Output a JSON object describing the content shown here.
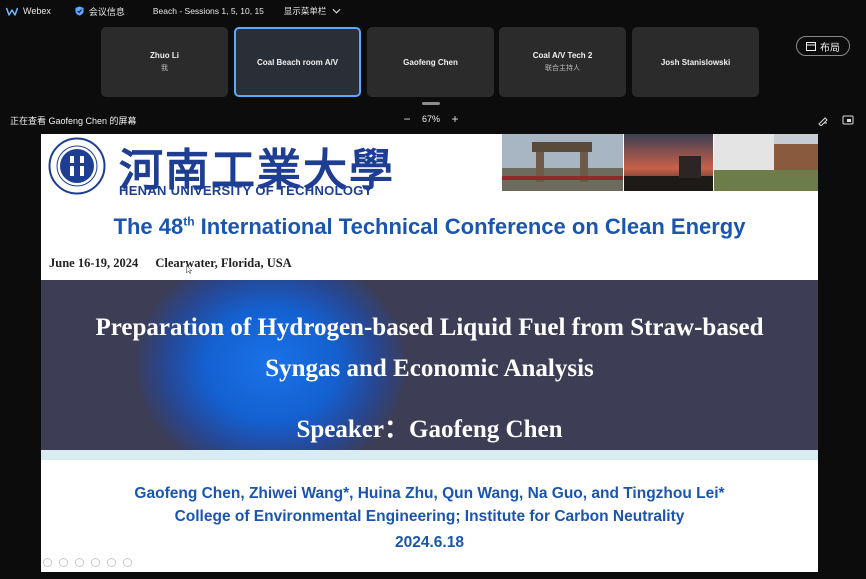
{
  "app": {
    "name": "Webex"
  },
  "topbar": {
    "meeting_info_label": "会议信息",
    "meeting_title": "Beach - Sessions 1, 5, 10, 15",
    "menubar_toggle_label": "显示菜单栏"
  },
  "participants": [
    {
      "name": "Zhuo Li",
      "sub": "我",
      "active": false
    },
    {
      "name": "Coal Beach room A/V",
      "sub": "",
      "active": true
    },
    {
      "name": "Gaofeng Chen",
      "sub": "",
      "active": false
    },
    {
      "name": "Coal A/V Tech 2",
      "sub": "联合主持人",
      "active": false
    },
    {
      "name": "Josh Stanislowski",
      "sub": "",
      "active": false
    }
  ],
  "layout_button_label": "布局",
  "viewbar": {
    "viewing_label": "正在查看 Gaofeng Chen 的屏幕",
    "zoom_minus": "−",
    "zoom_value": "67%",
    "zoom_plus": "+"
  },
  "slide": {
    "university_cn": "河南工業大學",
    "university_en": "HENAN UNIVERSITY OF TECHNOLOGY",
    "conference_title_prefix": "The 48",
    "conference_title_sup": "th",
    "conference_title_rest": " International Technical Conference on Clean Energy",
    "date": "June 16-19, 2024",
    "location": "Clearwater, Florida, USA",
    "talk_title_line1": "Preparation of Hydrogen-based Liquid Fuel from Straw-based",
    "talk_title_line2": "Syngas and Economic Analysis",
    "speaker": "Speaker：Gaofeng Chen",
    "authors": "Gaofeng Chen, Zhiwei Wang*, Huina Zhu, Qun Wang, Na Guo, and Tingzhou Lei*",
    "affiliation": "College of Environmental Engineering; Institute for Carbon Neutrality",
    "talk_date": "2024.6.18"
  },
  "colors": {
    "slide_blue": "#1a56b0",
    "band": "#3d3d55",
    "active_tile_border": "#5aa8ff"
  }
}
